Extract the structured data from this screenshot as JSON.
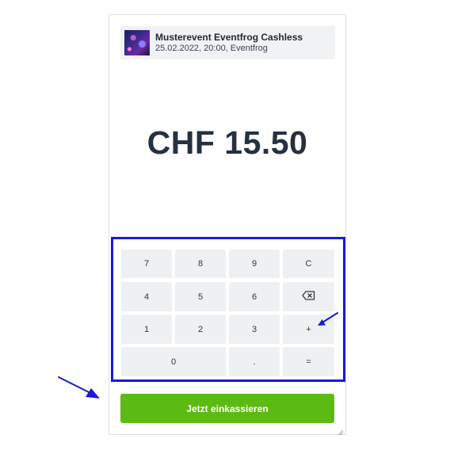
{
  "event": {
    "title": "Musterevent Eventfrog Cashless",
    "subtitle": "25.02.2022, 20:00, Eventfrog"
  },
  "amount": "CHF 15.50",
  "keypad": {
    "k7": "7",
    "k8": "8",
    "k9": "9",
    "clear": "C",
    "k4": "4",
    "k5": "5",
    "k6": "6",
    "k1": "1",
    "k2": "2",
    "k3": "3",
    "plus": "+",
    "k0": "0",
    "dot": ".",
    "equals": "="
  },
  "pay_button": {
    "label": "Jetzt einkassieren"
  },
  "colors": {
    "highlight": "#1919d8",
    "pay": "#5cbb12",
    "key_bg": "#eef0f2"
  }
}
